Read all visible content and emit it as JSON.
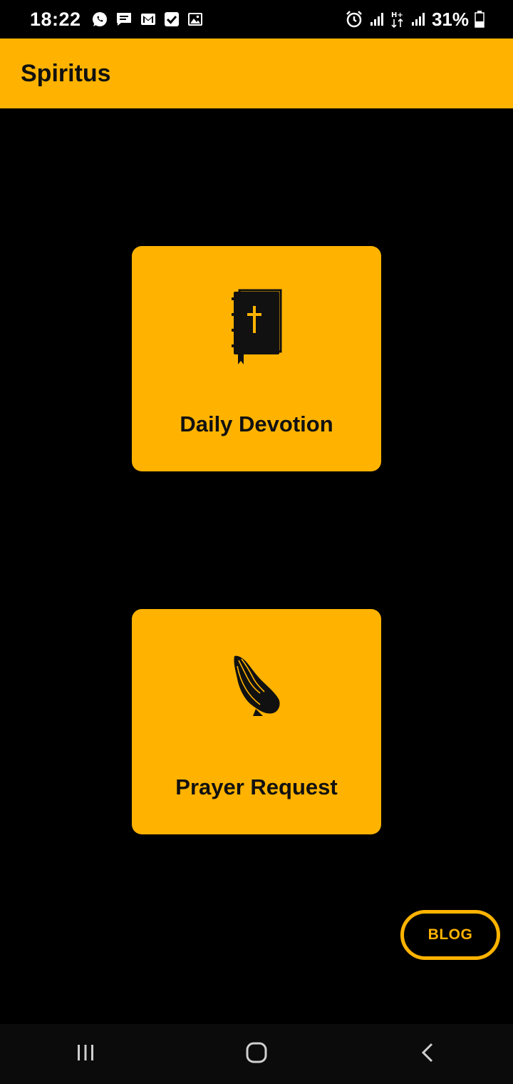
{
  "status_bar": {
    "time": "18:22",
    "battery": "31%",
    "notification_icons": [
      "whatsapp-icon",
      "message-icon",
      "gmail-icon",
      "checkbox-icon",
      "gallery-icon"
    ],
    "system_icons": [
      "alarm-icon",
      "signal-icon",
      "network-hplus-icon",
      "signal-icon",
      "battery-icon"
    ]
  },
  "app_bar": {
    "title": "Spiritus"
  },
  "cards": [
    {
      "label": "Daily Devotion",
      "icon": "bible-icon"
    },
    {
      "label": "Prayer Request",
      "icon": "praying-hands-icon"
    }
  ],
  "blog_button": {
    "label": "BLOG"
  },
  "nav_bar": {
    "buttons": [
      "recent-apps-icon",
      "home-icon",
      "back-icon"
    ]
  },
  "colors": {
    "accent": "#FFB300",
    "background": "#000000",
    "nav_background": "#0b0b0b",
    "text_dark": "#111111"
  }
}
